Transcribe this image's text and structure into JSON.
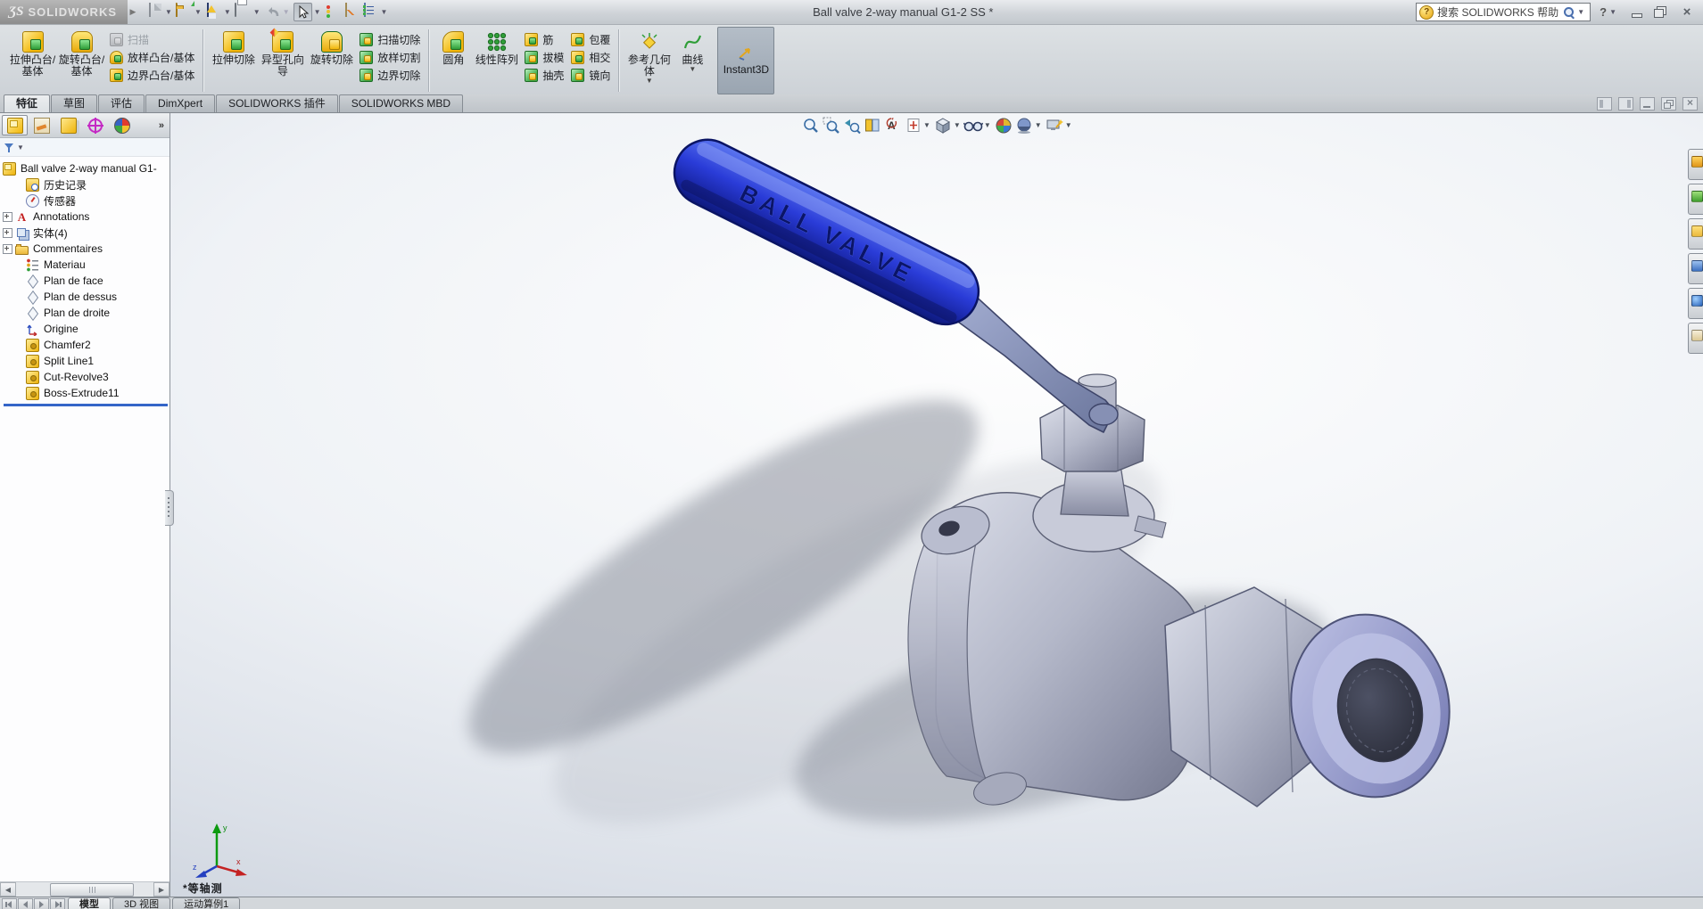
{
  "titlebar": {
    "logo_mark": "ƷS",
    "brand": "SOLIDWORKS",
    "title": "Ball valve 2-way manual G1-2 SS *",
    "search_placeholder": "搜索 SOLIDWORKS 帮助"
  },
  "quick_access_icons": [
    "new-document",
    "open",
    "save",
    "print",
    "undo",
    "select-arrow",
    "rebuild-traffic-light",
    "file-properties",
    "options-list"
  ],
  "ribbon": {
    "g1": {
      "b1": "拉伸凸台/基体",
      "b2": "旋转凸台/基体",
      "s1": "扫描",
      "s2": "放样凸台/基体",
      "s3": "边界凸台/基体"
    },
    "g2": {
      "b1": "拉伸切除",
      "b2": "异型孔向导",
      "b3": "旋转切除",
      "s1": "扫描切除",
      "s2": "放样切割",
      "s3": "边界切除"
    },
    "g3": {
      "b1": "圆角",
      "b2": "线性阵列",
      "s1": "筋",
      "s2": "拔模",
      "s3": "抽壳",
      "s4": "包覆",
      "s5": "相交",
      "s6": "镜向"
    },
    "g4": {
      "b1": "参考几何体",
      "b2": "曲线"
    },
    "instant3d": "Instant3D"
  },
  "tabs": {
    "items": [
      "特征",
      "草图",
      "评估",
      "DimXpert",
      "SOLIDWORKS 插件",
      "SOLIDWORKS MBD"
    ],
    "active_index": 0
  },
  "headsup_icons": [
    "zoom-to-fit",
    "zoom-to-area",
    "previous-view",
    "section-view",
    "annotation-view",
    "view-orientation",
    "display-style",
    "hide-show-items",
    "edit-appearance",
    "apply-scene",
    "view-settings"
  ],
  "tree": {
    "root": "Ball valve 2-way manual G1-",
    "items": [
      "历史记录",
      "传感器",
      "Annotations",
      "实体(4)",
      "Commentaires",
      "Materiau",
      "Plan de face",
      "Plan de dessus",
      "Plan de droite",
      "Origine",
      "Chamfer2",
      "Split Line1",
      "Cut-Revolve3",
      "Boss-Extrude11"
    ]
  },
  "taskpane_icons": [
    "solidworks-resources",
    "design-library",
    "file-explorer",
    "view-palette",
    "appearances-scenes",
    "custom-properties"
  ],
  "viewport": {
    "view_label": "*等轴测",
    "model_text": "BALL VALVE",
    "triad": {
      "x": "x",
      "y": "y",
      "z": "z"
    }
  },
  "bottom": {
    "tabs": [
      "模型",
      "3D 视图",
      "运动算例1"
    ],
    "active_index": 0
  }
}
